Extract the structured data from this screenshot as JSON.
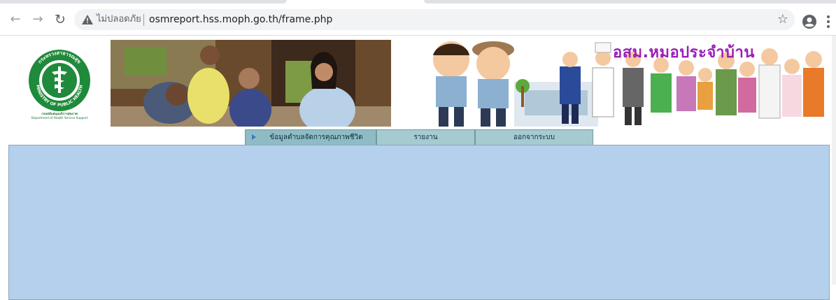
{
  "browser": {
    "security_label": "ไม่ปลอดภัย",
    "url": "osmreport.hss.moph.go.th/frame.php",
    "icons": [
      "back-arrow-icon",
      "forward-arrow-icon",
      "reload-icon",
      "warning-triangle-icon",
      "star-icon",
      "account-circle-icon",
      "more-vert-icon"
    ]
  },
  "header": {
    "logo_caption_line1": "กรมสนับสนุนบริการสุขภาพ",
    "logo_caption_line2": "Department of Health Service Support",
    "logo_ring_top": "กระทรวงสาธารณสุข",
    "logo_ring_bottom": "MINISTRY OF PUBLIC HEALTH",
    "banner_title": "อสม.หมอประจำบ้าน"
  },
  "menu": {
    "items": [
      {
        "label": "ข้อมูลตำบลจัดการคุณภาพชีวิต",
        "active": true
      },
      {
        "label": "รายงาน",
        "active": false
      },
      {
        "label": "ออกจากระบบ",
        "active": false
      }
    ]
  },
  "colors": {
    "menu_bg": "#a5cad0",
    "content_bg": "#b4d0ec",
    "title_purple": "#9a1fb8"
  }
}
